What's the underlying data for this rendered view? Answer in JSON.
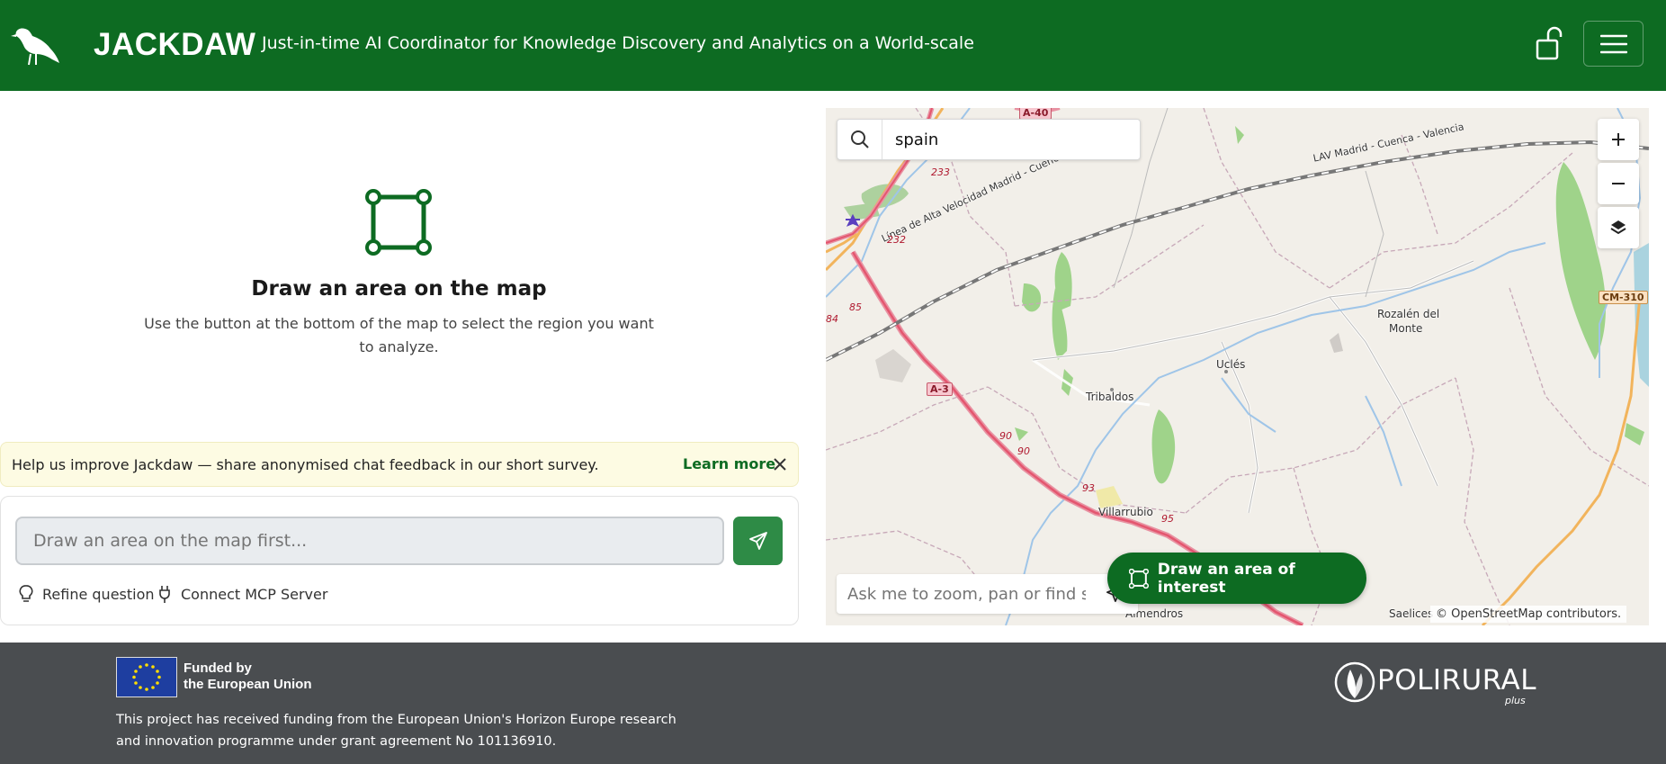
{
  "header": {
    "app_name": "JACKDAW",
    "subtitle": "Just-in-time AI Coordinator for Knowledge Discovery and Analytics on a World-scale",
    "logo_icon": "jackdaw-bird-icon",
    "lock_icon": "unlock-icon",
    "menu_icon": "hamburger-menu-icon",
    "bg_color": "#0d6b22"
  },
  "empty_state": {
    "icon": "draw-area-icon",
    "title": "Draw an area on the map",
    "description": "Use the button at the bottom of the map to select the region you want to analyze."
  },
  "survey": {
    "text": "Help us improve Jackdaw — share anonymised chat feedback in our short survey.",
    "link_label": "Learn more",
    "close_icon": "close-icon"
  },
  "chat": {
    "input_placeholder": "Draw an area on the map first...",
    "send_icon": "send-icon",
    "tools": [
      {
        "icon": "lightbulb-icon",
        "label": "Refine question"
      },
      {
        "icon": "plug-icon",
        "label": "Connect MCP Server"
      }
    ]
  },
  "map": {
    "search_value": "spain",
    "ask_placeholder": "Ask me to zoom, pan or find sc",
    "draw_button_label": "Draw an area of interest",
    "attribution": "© OpenStreetMap contributors.",
    "controls": [
      "zoom-in",
      "zoom-out",
      "layers"
    ],
    "places": {
      "ucles": "Uclés",
      "tribaldos": "Tribaldos",
      "rozalen1": "Rozalén del",
      "rozalen2": "Monte",
      "villarrubio": "Villarrubio",
      "almendros": "Almendros",
      "saelices": "Saelices",
      "rail1": "LAV Madrid - Cuenca - Valencia",
      "rail2": "Línea de Alta Velocidad Madrid - Cuenca - Valencia"
    },
    "shields": {
      "a3": "A-3",
      "a40": "A-40",
      "cm310": "CM-310"
    },
    "road_numbers": [
      "233",
      "232",
      "85",
      "84",
      "90",
      "90",
      "93",
      "95"
    ]
  },
  "footer": {
    "eu_line1": "Funded by",
    "eu_line2": "the European Union",
    "funding_text": "This project has received funding from the European Union's Horizon Europe research and innovation programme under grant agreement No 101136910.",
    "partner_name": "POLIRURAL",
    "partner_suffix": "plus"
  }
}
